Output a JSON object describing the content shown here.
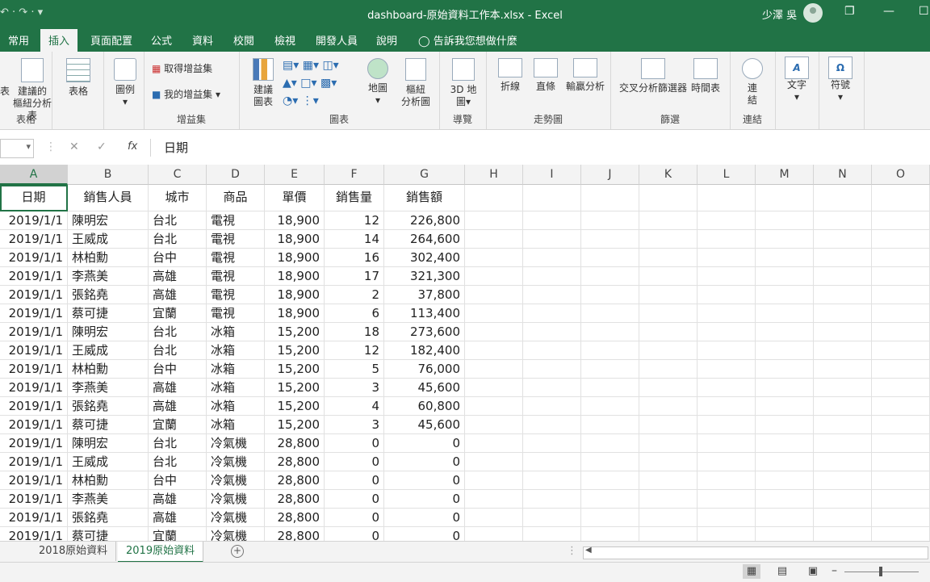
{
  "titlebar": {
    "qat": "↶ ·  ↷ ·  ▾",
    "title": "dashboard-原始資料工作本.xlsx  -  Excel",
    "user": "少澤 吳",
    "restore": "❐",
    "minimize": "—",
    "maximize": "☐"
  },
  "tabs": [
    "常用",
    "插入",
    "頁面配置",
    "公式",
    "資料",
    "校閱",
    "檢視",
    "開發人員",
    "說明"
  ],
  "tell_me": "告訴我您想做什麼",
  "ribbon": {
    "tables": {
      "pivot_partial": "表",
      "recommended_pivot": "建議的",
      "recommended_pivot2": "樞紐分析表",
      "table": "表格",
      "label": "表格"
    },
    "illustrations": {
      "illustrations": "圖例",
      "label": ""
    },
    "addins": {
      "get_addins": "取得增益集",
      "my_addins": "我的增益集",
      "label": "增益集"
    },
    "charts": {
      "recommended_charts": "建議",
      "recommended_charts2": "圖表",
      "maps": "地圖",
      "pivot_chart": "樞紐",
      "pivot_chart2": "分析圖",
      "label": "圖表"
    },
    "tours": {
      "map3d": "3D 地",
      "map3d2": "圖",
      "label": "導覽"
    },
    "sparklines": {
      "line": "折線",
      "column": "直條",
      "win_loss": "輸贏分析",
      "label": "走勢圖"
    },
    "filters": {
      "slicer": "交叉分析篩選器",
      "timeline": "時間表",
      "label": "篩選"
    },
    "links": {
      "link": "連",
      "link2": "結",
      "label": "連結"
    },
    "text": {
      "text": "文字"
    },
    "symbols": {
      "symbol": "符號"
    }
  },
  "formula_bar": {
    "content": "日期",
    "cancel": "✕",
    "enter": "✓",
    "fx": "fx"
  },
  "columns": [
    "A",
    "B",
    "C",
    "D",
    "E",
    "F",
    "G",
    "H",
    "I",
    "J",
    "K",
    "L",
    "M",
    "N",
    "O"
  ],
  "headers": [
    "日期",
    "銷售人員",
    "城市",
    "商品",
    "單價",
    "銷售量",
    "銷售額"
  ],
  "rows": [
    [
      "2019/1/1",
      "陳明宏",
      "台北",
      "電視",
      "18,900",
      "12",
      "226,800"
    ],
    [
      "2019/1/1",
      "王威成",
      "台北",
      "電視",
      "18,900",
      "14",
      "264,600"
    ],
    [
      "2019/1/1",
      "林柏勳",
      "台中",
      "電視",
      "18,900",
      "16",
      "302,400"
    ],
    [
      "2019/1/1",
      "李燕美",
      "高雄",
      "電視",
      "18,900",
      "17",
      "321,300"
    ],
    [
      "2019/1/1",
      "張銘堯",
      "高雄",
      "電視",
      "18,900",
      "2",
      "37,800"
    ],
    [
      "2019/1/1",
      "蔡可捷",
      "宜蘭",
      "電視",
      "18,900",
      "6",
      "113,400"
    ],
    [
      "2019/1/1",
      "陳明宏",
      "台北",
      "冰箱",
      "15,200",
      "18",
      "273,600"
    ],
    [
      "2019/1/1",
      "王威成",
      "台北",
      "冰箱",
      "15,200",
      "12",
      "182,400"
    ],
    [
      "2019/1/1",
      "林柏勳",
      "台中",
      "冰箱",
      "15,200",
      "5",
      "76,000"
    ],
    [
      "2019/1/1",
      "李燕美",
      "高雄",
      "冰箱",
      "15,200",
      "3",
      "45,600"
    ],
    [
      "2019/1/1",
      "張銘堯",
      "高雄",
      "冰箱",
      "15,200",
      "4",
      "60,800"
    ],
    [
      "2019/1/1",
      "蔡可捷",
      "宜蘭",
      "冰箱",
      "15,200",
      "3",
      "45,600"
    ],
    [
      "2019/1/1",
      "陳明宏",
      "台北",
      "冷氣機",
      "28,800",
      "0",
      "0"
    ],
    [
      "2019/1/1",
      "王威成",
      "台北",
      "冷氣機",
      "28,800",
      "0",
      "0"
    ],
    [
      "2019/1/1",
      "林柏勳",
      "台中",
      "冷氣機",
      "28,800",
      "0",
      "0"
    ],
    [
      "2019/1/1",
      "李燕美",
      "高雄",
      "冷氣機",
      "28,800",
      "0",
      "0"
    ],
    [
      "2019/1/1",
      "張銘堯",
      "高雄",
      "冷氣機",
      "28,800",
      "0",
      "0"
    ],
    [
      "2019/1/1",
      "蔡可捷",
      "宜蘭",
      "冷氣機",
      "28,800",
      "0",
      "0"
    ]
  ],
  "sheets": [
    "2018原始資料",
    "2019原始資料"
  ],
  "colors": {
    "accent": "#217346"
  }
}
